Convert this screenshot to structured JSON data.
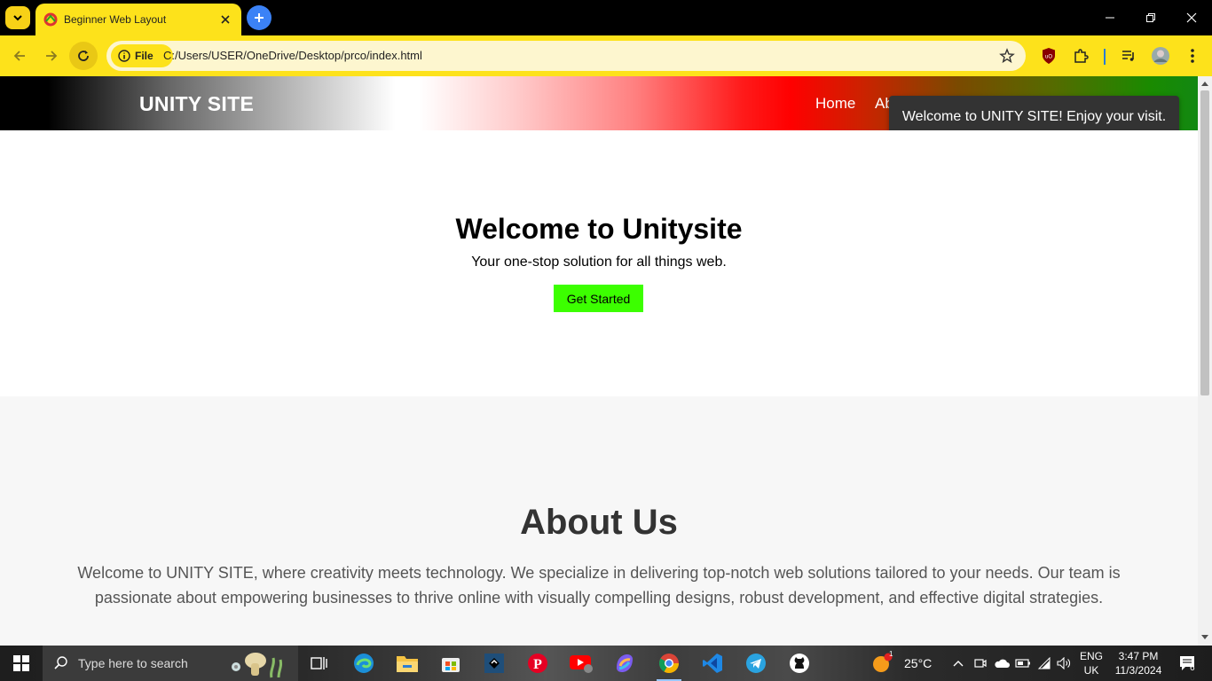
{
  "browser": {
    "tab_title": "Beginner Web Layout",
    "url_chip": "File",
    "url": "C:/Users/USER/OneDrive/Desktop/prco/index.html"
  },
  "site": {
    "brand": "UNITY SITE",
    "nav": [
      "Home",
      "Ab"
    ],
    "toast": "Welcome to UNITY SITE! Enjoy your visit.",
    "hero": {
      "title": "Welcome to Unitysite",
      "subtitle": "Your one-stop solution for all things web.",
      "button": "Get Started"
    },
    "about": {
      "title": "About Us",
      "text": "Welcome to UNITY SITE, where creativity meets technology. We specialize in delivering top-notch web solutions tailored to your needs. Our team is passionate about empowering businesses to thrive online with visually compelling designs, robust development, and effective digital strategies."
    },
    "colors": {
      "cta": "#3cff00",
      "browser_theme": "#fde21b",
      "toast_bg": "#333333"
    }
  },
  "taskbar": {
    "search_placeholder": "Type here to search",
    "weather": "25°C",
    "weather_badge": "1",
    "language": "ENG",
    "region": "UK",
    "time": "3:47 PM",
    "date": "11/3/2024",
    "notifications": "6"
  }
}
